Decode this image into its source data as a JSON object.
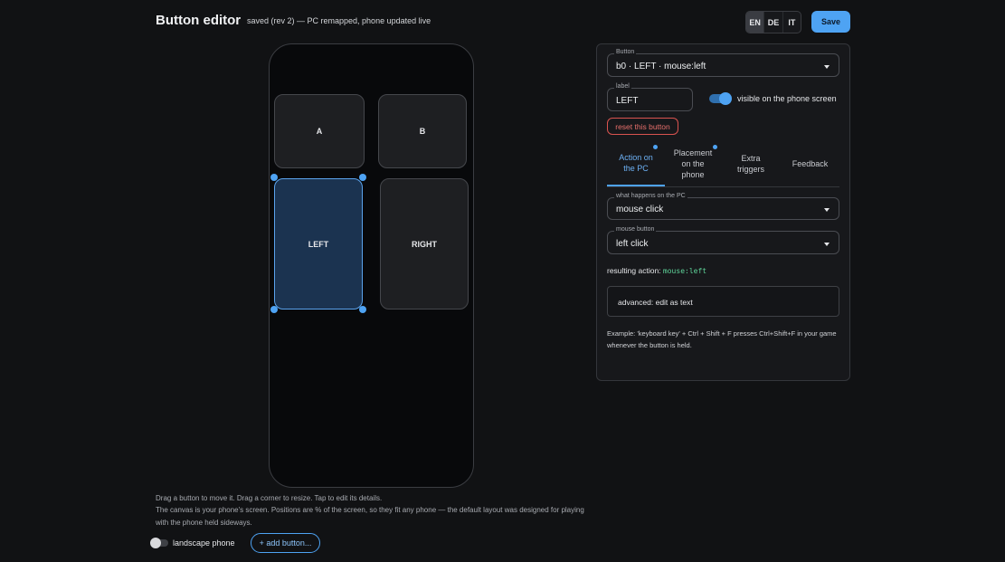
{
  "header": {
    "title": "Button editor",
    "status": "saved (rev 2) — PC remapped, phone updated live",
    "languages": [
      {
        "code": "EN",
        "active": true
      },
      {
        "code": "DE",
        "active": false
      },
      {
        "code": "IT",
        "active": false
      }
    ],
    "save_label": "Save"
  },
  "canvas": {
    "buttons": [
      {
        "label": "A",
        "selected": false
      },
      {
        "label": "B",
        "selected": false
      },
      {
        "label": "LEFT",
        "selected": true
      },
      {
        "label": "RIGHT",
        "selected": false
      }
    ]
  },
  "help": {
    "line1": "Drag a button to move it. Drag a corner to resize. Tap to edit its details.",
    "line2": "The canvas is your phone's screen. Positions are % of the screen, so they fit any phone — the default layout was designed for playing",
    "line3": "with the phone held sideways."
  },
  "controls": {
    "landscape_label": "landscape phone",
    "landscape_on": false,
    "add_button_label": "+ add button..."
  },
  "panel": {
    "button_select": {
      "label": "Button",
      "value": "b0 · LEFT · mouse:left"
    },
    "label_field": {
      "label": "label",
      "value": "LEFT"
    },
    "visible_toggle": {
      "label": "visible on the phone screen",
      "on": true
    },
    "reset_label": "reset this button",
    "tabs": [
      {
        "label": "Action on the PC",
        "active": true,
        "dot": true
      },
      {
        "label": "Placement on the phone",
        "active": false,
        "dot": true
      },
      {
        "label": "Extra triggers",
        "active": false,
        "dot": false
      },
      {
        "label": "Feedback",
        "active": false,
        "dot": false
      }
    ],
    "action_select": {
      "label": "what happens on the PC",
      "value": "mouse click"
    },
    "mouse_select": {
      "label": "mouse button",
      "value": "left click"
    },
    "result": {
      "label": "resulting action:",
      "code": "mouse:left"
    },
    "advanced_label": "advanced: edit as text",
    "example": "Example: 'keyboard key' + Ctrl + Shift + F presses Ctrl+Shift+F in your game whenever the button is held."
  }
}
